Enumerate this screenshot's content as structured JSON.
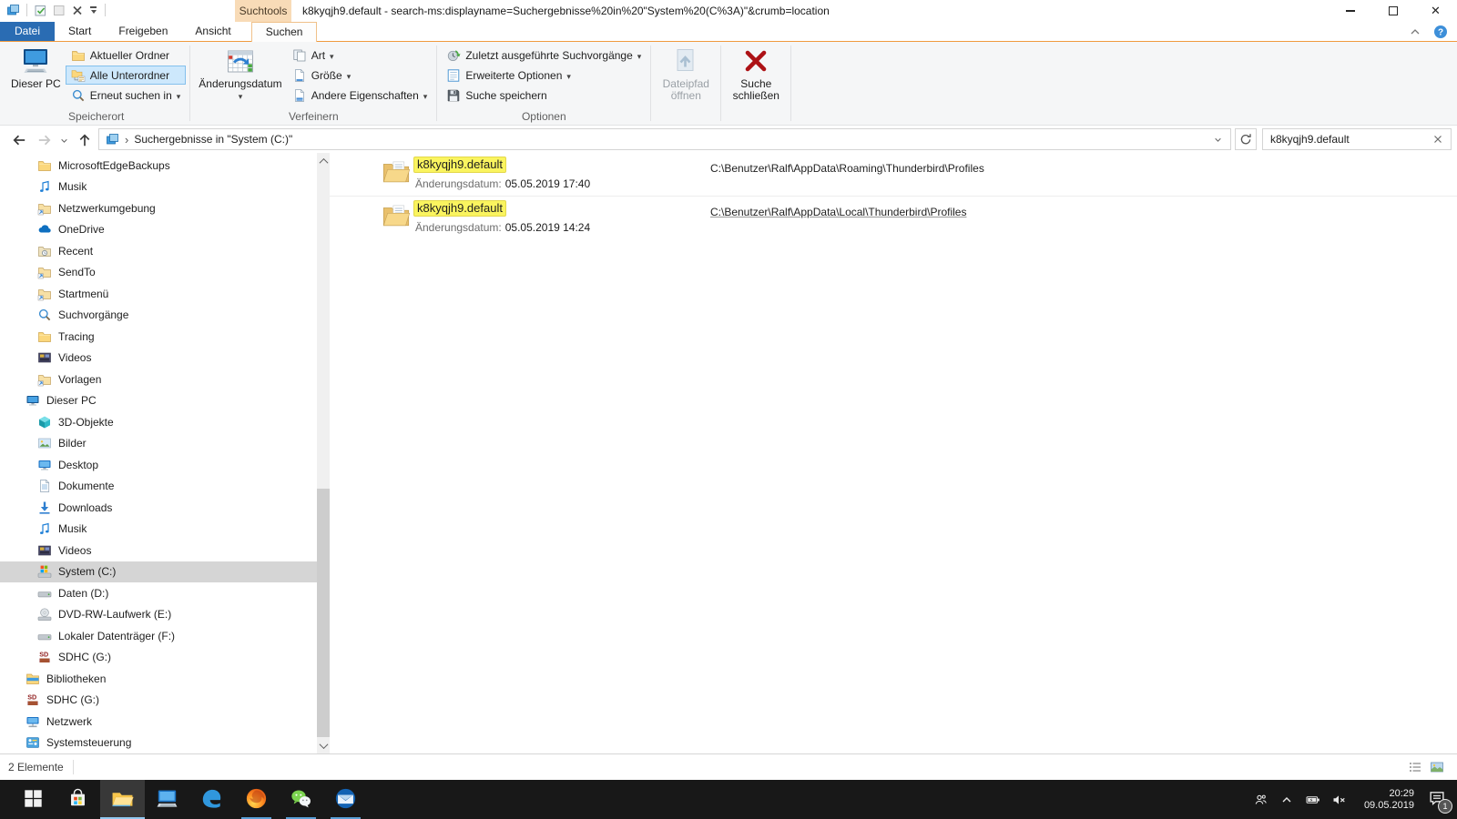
{
  "titlebar": {
    "contextual_header": "Suchtools",
    "title": "k8kyqjh9.default - search-ms:displayname=Suchergebnisse%20in%20\"System%20(C%3A)\"&crumb=location"
  },
  "tabs": {
    "file": "Datei",
    "static": [
      "Start",
      "Freigeben",
      "Ansicht"
    ],
    "active": "Suchen"
  },
  "ribbon": {
    "location": {
      "label": "Speicherort",
      "this_pc": "Dieser PC",
      "current_folder": "Aktueller Ordner",
      "all_subfolders": "Alle Unterordner",
      "search_again_in": "Erneut suchen in"
    },
    "refine": {
      "label": "Verfeinern",
      "date_modified": "Änderungsdatum",
      "kind": "Art",
      "size": "Größe",
      "other_properties": "Andere Eigenschaften"
    },
    "options": {
      "label": "Optionen",
      "recent_searches": "Zuletzt ausgeführte Suchvorgänge",
      "advanced_options": "Erweiterte Optionen",
      "save_search": "Suche speichern"
    },
    "open_file_location": "Dateipfad öffnen",
    "close_search": "Suche schließen"
  },
  "addressbar": {
    "breadcrumb": "Suchergebnisse in \"System (C:)\"",
    "search_value": "k8kyqjh9.default"
  },
  "sidebar": {
    "items": [
      {
        "label": "MicrosoftEdgeBackups",
        "icon": "folder",
        "indent": 2
      },
      {
        "label": "Musik",
        "icon": "music",
        "indent": 2
      },
      {
        "label": "Netzwerkumgebung",
        "icon": "folder-link",
        "indent": 2
      },
      {
        "label": "OneDrive",
        "icon": "onedrive",
        "indent": 2
      },
      {
        "label": "Recent",
        "icon": "recent",
        "indent": 2
      },
      {
        "label": "SendTo",
        "icon": "folder-link",
        "indent": 2
      },
      {
        "label": "Startmenü",
        "icon": "folder-link",
        "indent": 2
      },
      {
        "label": "Suchvorgänge",
        "icon": "search",
        "indent": 2
      },
      {
        "label": "Tracing",
        "icon": "folder",
        "indent": 2
      },
      {
        "label": "Videos",
        "icon": "video",
        "indent": 2
      },
      {
        "label": "Vorlagen",
        "icon": "folder-link",
        "indent": 2
      },
      {
        "label": "Dieser PC",
        "icon": "pc",
        "indent": 1
      },
      {
        "label": "3D-Objekte",
        "icon": "cube",
        "indent": 2
      },
      {
        "label": "Bilder",
        "icon": "picture",
        "indent": 2
      },
      {
        "label": "Desktop",
        "icon": "desktop",
        "indent": 2
      },
      {
        "label": "Dokumente",
        "icon": "document",
        "indent": 2
      },
      {
        "label": "Downloads",
        "icon": "download",
        "indent": 2
      },
      {
        "label": "Musik",
        "icon": "music",
        "indent": 2
      },
      {
        "label": "Videos",
        "icon": "video",
        "indent": 2
      },
      {
        "label": "System (C:)",
        "icon": "drive-sys",
        "indent": 2,
        "selected": true
      },
      {
        "label": "Daten (D:)",
        "icon": "drive",
        "indent": 2
      },
      {
        "label": "DVD-RW-Laufwerk (E:)",
        "icon": "dvd",
        "indent": 2
      },
      {
        "label": "Lokaler Datenträger (F:)",
        "icon": "drive",
        "indent": 2
      },
      {
        "label": "SDHC (G:)",
        "icon": "sd",
        "indent": 2
      },
      {
        "label": "Bibliotheken",
        "icon": "library",
        "indent": 1
      },
      {
        "label": "SDHC (G:)",
        "icon": "sd",
        "indent": 1
      },
      {
        "label": "Netzwerk",
        "icon": "network",
        "indent": 1
      },
      {
        "label": "Systemsteuerung",
        "icon": "controlpanel",
        "indent": 1
      }
    ]
  },
  "results": {
    "items": [
      {
        "name": "k8kyqjh9.default",
        "date_label": "Änderungsdatum:",
        "date": "05.05.2019 17:40",
        "path": "C:\\Benutzer\\Ralf\\AppData\\Roaming\\Thunderbird\\Profiles"
      },
      {
        "name": "k8kyqjh9.default",
        "date_label": "Änderungsdatum:",
        "date": "05.05.2019 14:24",
        "path": "C:\\Benutzer\\Ralf\\AppData\\Local\\Thunderbird\\Profiles"
      }
    ]
  },
  "statusbar": {
    "count": "2 Elemente"
  },
  "taskbar": {
    "apps": [
      {
        "name": "taskbar-start",
        "icon": "win"
      },
      {
        "name": "taskbar-store",
        "icon": "store"
      },
      {
        "name": "taskbar-explorer",
        "icon": "explorer",
        "active": true
      },
      {
        "name": "taskbar-desktop",
        "icon": "monitor"
      },
      {
        "name": "taskbar-edge",
        "icon": "edge"
      },
      {
        "name": "taskbar-firefox",
        "icon": "firefox",
        "running": true
      },
      {
        "name": "taskbar-wechat",
        "icon": "wechat",
        "running": true
      },
      {
        "name": "taskbar-thunderbird",
        "icon": "thunderbird",
        "running": true
      }
    ],
    "clock_time": "20:29",
    "clock_date": "09.05.2019",
    "badge": "1"
  },
  "colors": {
    "accent_blue": "#2a6cb3",
    "contextual_orange": "#f8dbb7",
    "highlight_yellow": "#faf45f",
    "selection_gray": "#d5d5d5",
    "close_red": "#ad1216"
  }
}
